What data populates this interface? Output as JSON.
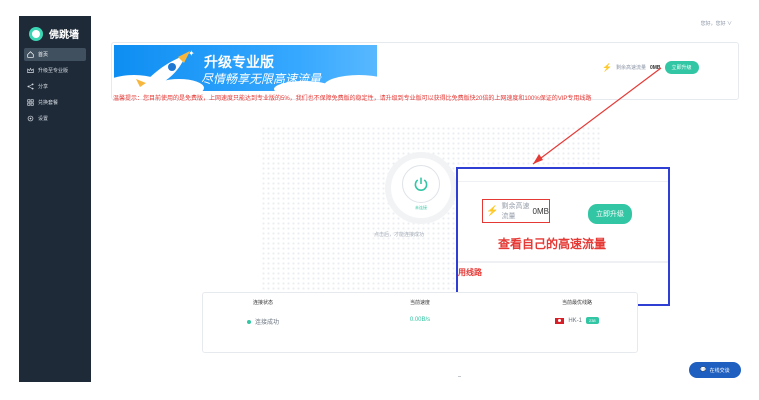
{
  "app": {
    "name": "佛跳墙"
  },
  "header": {
    "user_menu": "您好，您好 ∨"
  },
  "sidebar": {
    "items": [
      {
        "label": "首页",
        "icon": "home-icon",
        "active": true
      },
      {
        "label": "升级至专业版",
        "icon": "crown-icon",
        "active": false
      },
      {
        "label": "分享",
        "icon": "share-icon",
        "active": false
      },
      {
        "label": "兑换套餐",
        "icon": "grid-icon",
        "active": false
      },
      {
        "label": "设置",
        "icon": "gear-icon",
        "active": false
      }
    ]
  },
  "banner": {
    "title": "升级专业版",
    "subtitle": "尽情畅享无限高速流量"
  },
  "traffic": {
    "label": "剩余高速流量",
    "value": "0MB",
    "upgrade_label": "立即升级"
  },
  "notice": "温馨提示：您目前使用的是免费版，上网速度只能达到专业版的5%，我们也不保障免费版的稳定性，请升级到专业版可以获得比免费版快20倍的上网速度和100%保证的VIP专用线路",
  "power": {
    "label": "未连接",
    "hint": "点击后，才能连接成功"
  },
  "callout": {
    "label": "剩余高速流量",
    "value": "0MB",
    "button": "立即升级",
    "caption": "查看自己的高速流量",
    "route_text": "用线路"
  },
  "status": {
    "connection_head": "连接状态",
    "connection_value": "连接成功",
    "speed_head": "当前速度",
    "speed_value": "0.00B/s",
    "route_head": "当前最优线路",
    "route_value": "HK-1",
    "route_tag": "238"
  },
  "chat": {
    "label": "在线交谈"
  },
  "colors": {
    "sidebar": "#1e2a38",
    "accent": "#33c6a4",
    "alert": "#e53935",
    "callout_border": "#2f3fd3"
  }
}
